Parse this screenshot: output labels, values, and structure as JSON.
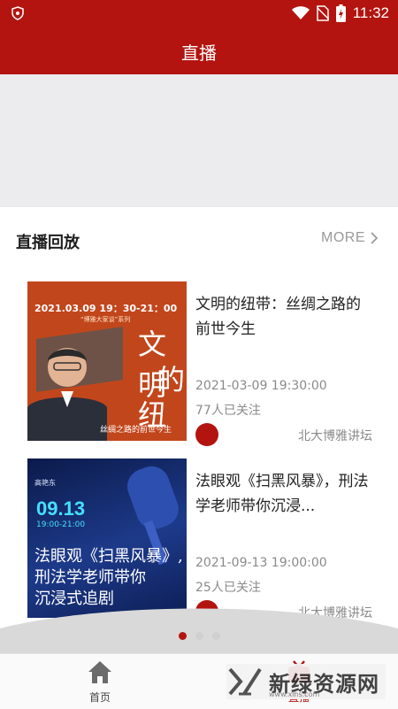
{
  "status_bar": {
    "time": "11:32"
  },
  "header": {
    "title": "直播"
  },
  "section": {
    "title": "直播回放",
    "more_label": "MORE"
  },
  "cards": [
    {
      "title": "文明的纽带：丝绸之路的前世今生",
      "date": "2021-03-09 19:30:00",
      "followers": "77人已关注",
      "org": "北大博雅讲坛",
      "thumb": {
        "date_line": "2021.03.09 19：30-21：00",
        "series": "“博雅大家谈”系列",
        "big1": "文明",
        "big2": "的",
        "big3": "纽带",
        "sub": "丝绸之路的前世今生"
      }
    },
    {
      "title": "法眼观《扫黑风暴》，刑法学老师带你沉浸...",
      "date": "2021-09-13 19:00:00",
      "followers": "25人已关注",
      "org": "北大博雅讲坛",
      "thumb": {
        "lecturer": "高艳东",
        "date_big": "09.13",
        "time": "19:00-21:00",
        "line1": "法眼观《扫黑风暴》,",
        "line2": "刑法学老师带你",
        "line3": "沉浸式追剧"
      }
    }
  ],
  "pager": {
    "count": 3,
    "active": 0
  },
  "tabbar": {
    "home_label": "首页",
    "live_label": "直播"
  },
  "watermark": {
    "text": "新绿资源网",
    "url": "www.xlhs.com"
  },
  "colors": {
    "brand": "#b3140f",
    "text_muted": "#8a8a8a"
  }
}
